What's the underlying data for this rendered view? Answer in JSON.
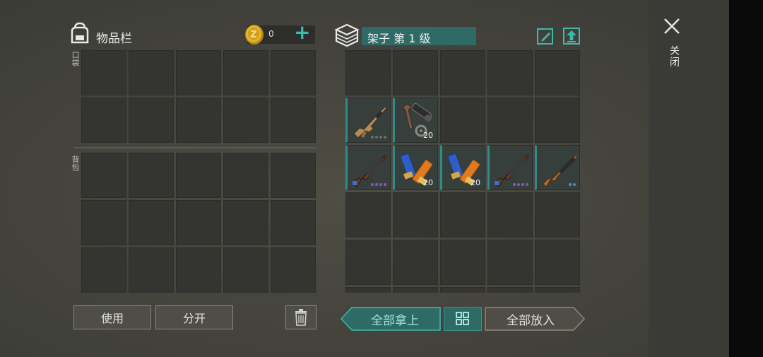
{
  "inventory": {
    "title": "物品栏",
    "coins": "0",
    "add_symbol": "+",
    "pockets_label": "口袋",
    "backpack_label": "背包"
  },
  "shelf": {
    "title": "架子 第 1 级"
  },
  "shelf_items": [
    {
      "row": 1,
      "col": 0,
      "icon": "assault-rifle-tan-icon",
      "quantity": "",
      "durability_dots": [
        "#6b6b6b",
        "#6b6b6b",
        "#6b6b6b",
        "#6b6b6b"
      ]
    },
    {
      "row": 1,
      "col": 1,
      "icon": "scope-mount-parts-icon",
      "quantity": "20",
      "durability_dots": []
    },
    {
      "row": 2,
      "col": 0,
      "icon": "ak-rifle-icon",
      "quantity": "",
      "durability_dots": [
        "#8a4fcf",
        "#8a4fcf",
        "#8a4fcf",
        "#8a4fcf"
      ]
    },
    {
      "row": 2,
      "col": 1,
      "icon": "shotgun-shells-icon",
      "quantity": "20",
      "durability_dots": []
    },
    {
      "row": 2,
      "col": 2,
      "icon": "shotgun-shells-icon",
      "quantity": "20",
      "durability_dots": []
    },
    {
      "row": 2,
      "col": 3,
      "icon": "ak-rifle-icon",
      "quantity": "",
      "durability_dots": [
        "#8a4fcf",
        "#8a4fcf",
        "#8a4fcf",
        "#6b6b6b"
      ]
    },
    {
      "row": 2,
      "col": 4,
      "icon": "hunting-rifle-icon",
      "quantity": "",
      "durability_dots": [
        "#3a3a3a",
        "#3a3a3a",
        "#3a8fd6",
        "#3a8fd6"
      ]
    }
  ],
  "buttons": {
    "use": "使用",
    "split": "分开",
    "take_all": "全部拿上",
    "put_all": "全部放入",
    "close": "关闭"
  },
  "colors": {
    "accent": "#2e6b67",
    "accent_bright": "#3fb8ad",
    "coin": "#d9a520"
  }
}
